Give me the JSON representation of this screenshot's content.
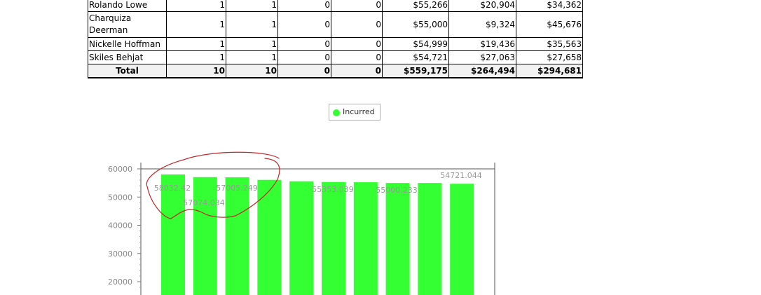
{
  "table": {
    "rows": [
      {
        "name": "Rolando Lowe",
        "c1": "1",
        "c2": "1",
        "c3": "0",
        "c4": "0",
        "c5": "$55,266",
        "c6": "$20,904",
        "c7": "$34,362"
      },
      {
        "name": "Charquiza Deerman",
        "c1": "1",
        "c2": "1",
        "c3": "0",
        "c4": "0",
        "c5": "$55,000",
        "c6": "$9,324",
        "c7": "$45,676"
      },
      {
        "name": "Nickelle Hoffman",
        "c1": "1",
        "c2": "1",
        "c3": "0",
        "c4": "0",
        "c5": "$54,999",
        "c6": "$19,436",
        "c7": "$35,563"
      },
      {
        "name": "Skiles Behjat",
        "c1": "1",
        "c2": "1",
        "c3": "0",
        "c4": "0",
        "c5": "$54,721",
        "c6": "$27,063",
        "c7": "$27,658"
      }
    ],
    "total": {
      "name": "Total",
      "c1": "10",
      "c2": "10",
      "c3": "0",
      "c4": "0",
      "c5": "$559,175",
      "c6": "$264,494",
      "c7": "$294,681"
    }
  },
  "legend": {
    "label": "Incurred"
  },
  "colors": {
    "bar": "#33ff33",
    "annotation": "#c0282a"
  },
  "chart_data": {
    "type": "bar",
    "series": [
      {
        "name": "Incurred",
        "values": [
          58032.42,
          57074.034,
          57005.249,
          56100,
          55600,
          55353.039,
          55266,
          55000.233,
          54999,
          54721.044
        ]
      }
    ],
    "data_labels": [
      "58032.42",
      "57074.034",
      "57005.249",
      "",
      "",
      "55353.039",
      "",
      "55000.233",
      "",
      "54721.044"
    ],
    "y_ticks": [
      "60000",
      "50000",
      "40000",
      "30000",
      "20000"
    ],
    "ylim": [
      15000,
      62000
    ],
    "grid": false,
    "legend_position": "top-center"
  }
}
